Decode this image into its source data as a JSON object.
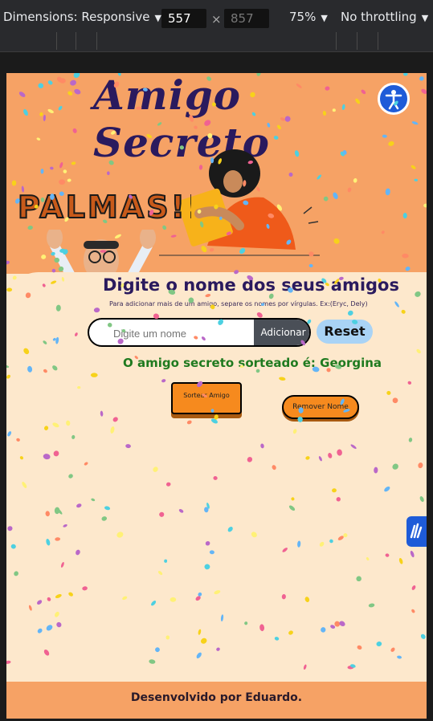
{
  "devtools": {
    "dimensions_label": "Dimensions: Responsive",
    "width": "557",
    "times": "×",
    "height": "857",
    "zoom": "75%",
    "throttling": "No throttling"
  },
  "page": {
    "title": "Amigo Secreto",
    "accessibility_icon": "accessibility-icon",
    "sticker_text": "PALMAS!!",
    "section_title": "Digite o nome dos seus amigos",
    "hint": "Para adicionar mais de um amigo, separe os nomes por vírgulas. Ex:(Eryc, Dely)",
    "input_placeholder": "Digite um nome",
    "add_label": "Adicionar",
    "reset_label": "Reset",
    "result": "O amigo secreto sorteado é: Georgina",
    "draw_label": "Sortear Amigo",
    "remove_label": "Remover Nome",
    "footer": "Desenvolvido por Eduardo."
  },
  "colors": {
    "header_bg": "#f6a265",
    "body_bg": "#fde8cc",
    "title": "#2a1a5e",
    "result": "#1f7a1f",
    "button_orange": "#f68a1e",
    "accent_blue": "#1e5bd8"
  }
}
